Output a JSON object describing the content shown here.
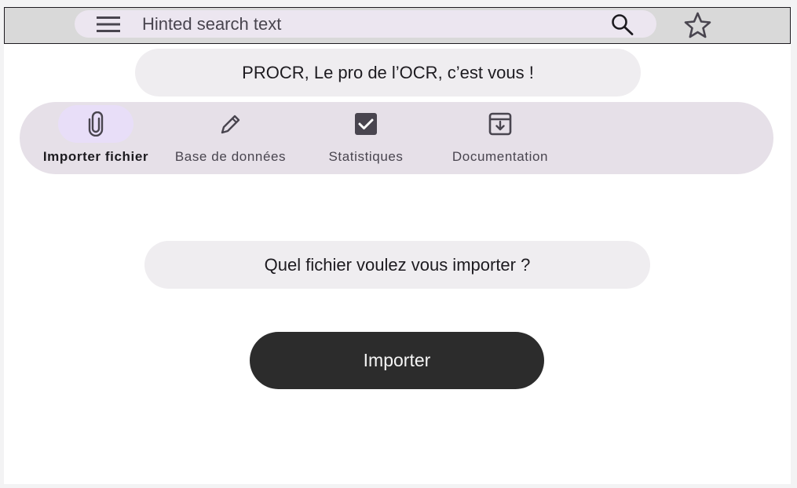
{
  "search": {
    "placeholder": "Hinted search text",
    "menu_icon": "menu-icon",
    "search_icon": "search-icon"
  },
  "favorite_icon": "star-icon",
  "header": {
    "title": "PROCR, Le pro de l’OCR, c’est vous !"
  },
  "nav": {
    "items": [
      {
        "label": "Importer fichier",
        "icon": "paperclip-icon",
        "active": true
      },
      {
        "label": "Base de données",
        "icon": "pencil-icon",
        "active": false
      },
      {
        "label": "Statistiques",
        "icon": "checkbox-icon",
        "active": false
      },
      {
        "label": "Documentation",
        "icon": "archive-icon",
        "active": false
      }
    ]
  },
  "main": {
    "question": "Quel fichier voulez vous importer ?",
    "import_button": "Importer"
  },
  "colors": {
    "nav_background": "#e6e0e8",
    "active_indicator": "#e8def8",
    "button": "#2c2c2c",
    "search_bar": "#ece6f0"
  }
}
